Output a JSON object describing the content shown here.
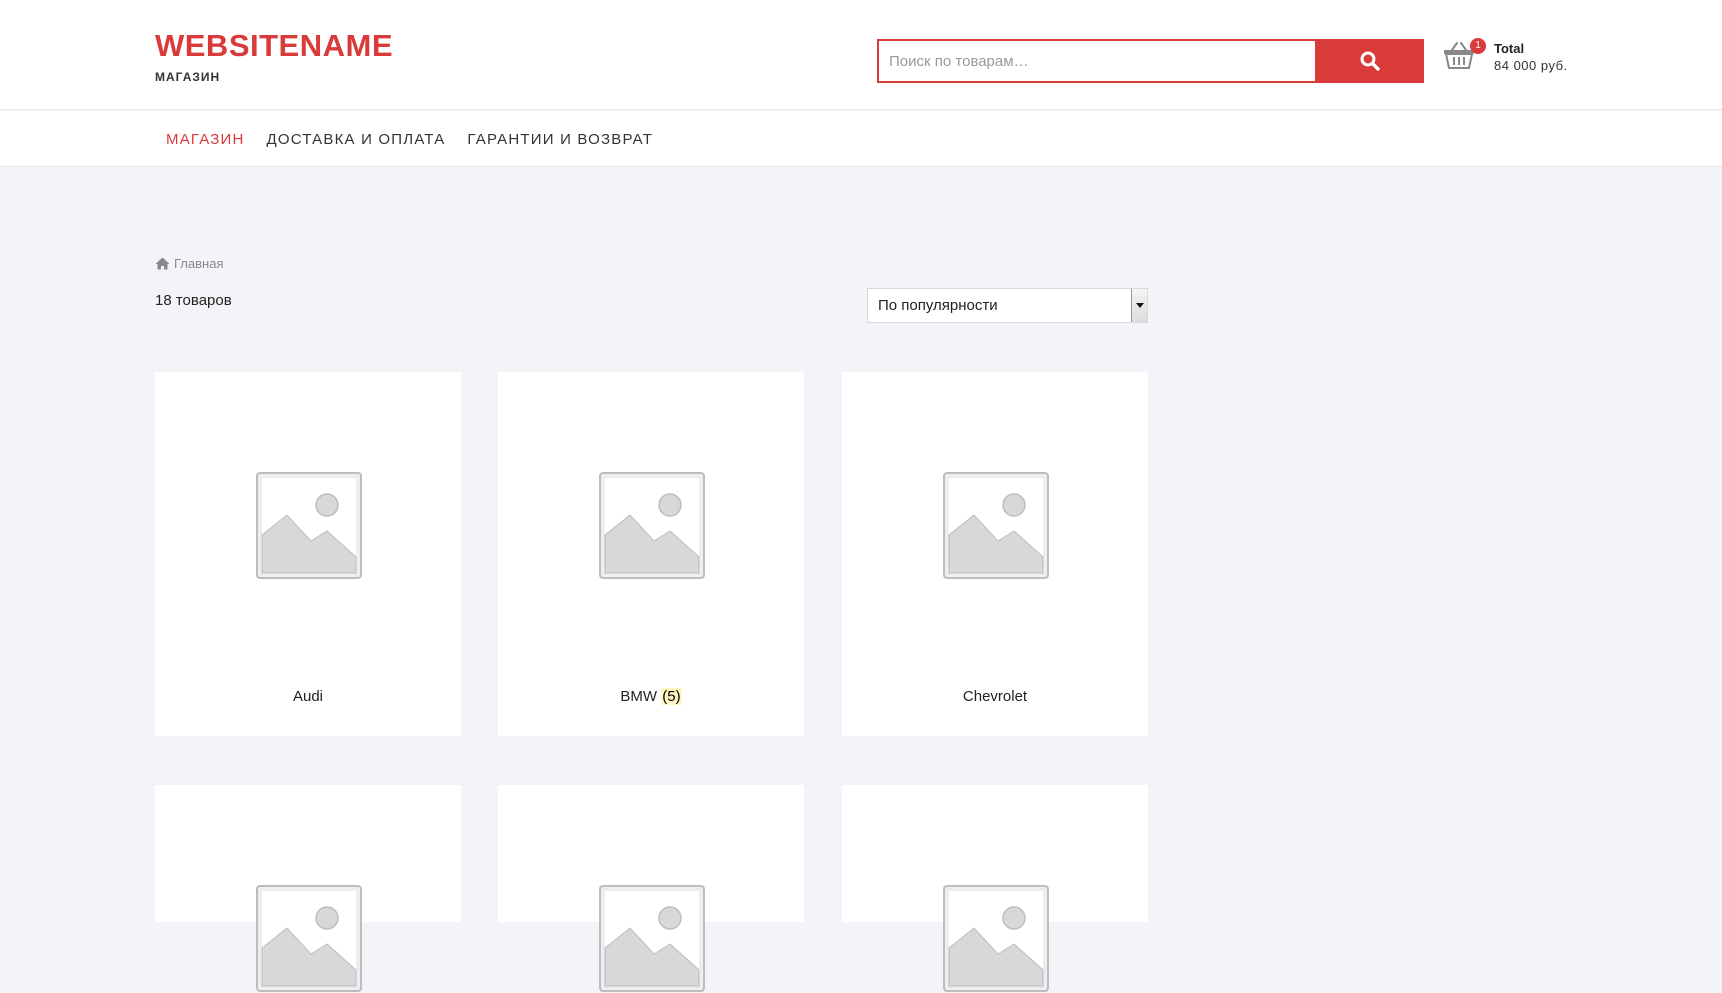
{
  "header": {
    "site_title": "WEBSITENAME",
    "tagline": "МАГАЗИН",
    "search_placeholder": "Поиск по товарам…",
    "cart": {
      "badge": "1",
      "label": "Total",
      "amount": "84 000 руб."
    }
  },
  "nav": {
    "items": [
      {
        "label": "МАГАЗИН"
      },
      {
        "label": "ДОСТАВКА И ОПЛАТА"
      },
      {
        "label": "ГАРАНТИИ И ВОЗВРАТ"
      }
    ]
  },
  "breadcrumb": {
    "home_label": "Главная"
  },
  "result_count": "18 товаров",
  "sort": {
    "selected": "По популярности"
  },
  "categories": [
    {
      "name": "Audi",
      "count": ""
    },
    {
      "name": "BMW",
      "count": "(5)"
    },
    {
      "name": "Chevrolet",
      "count": ""
    }
  ],
  "colors": {
    "accent": "#d93b3b",
    "page_bg": "#f3f4f7"
  },
  "icons": {
    "search": "search-icon",
    "cart": "basket-icon",
    "home": "home-icon",
    "placeholder": "image-placeholder-icon"
  }
}
